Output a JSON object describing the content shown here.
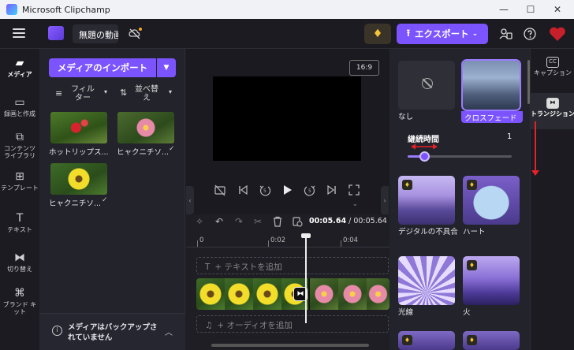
{
  "window": {
    "title": "Microsoft Clipchamp",
    "minimize": "—",
    "maximize": "☐",
    "close": "✕"
  },
  "appbar": {
    "project_name": "無題の動画",
    "export_label": "エクスポート",
    "export_up": "⭱",
    "export_chevron": "⌄",
    "premium_glyph": "♦"
  },
  "leftnav": [
    {
      "label": "メディア",
      "icon": "folder-icon",
      "glyph": "▰"
    },
    {
      "label": "録画と作成",
      "icon": "camera-icon",
      "glyph": "▭"
    },
    {
      "label": "コンテンツ ライブラリ",
      "icon": "library-icon",
      "glyph": "⧉"
    },
    {
      "label": "テンプレート",
      "icon": "templates-icon",
      "glyph": "⊞"
    },
    {
      "label": "テキスト",
      "icon": "text-icon",
      "glyph": "T"
    },
    {
      "label": "切り替え",
      "icon": "transitions-icon",
      "glyph": "⧓"
    },
    {
      "label": "ブランド キット",
      "icon": "brand-kit-icon",
      "glyph": "⌘"
    }
  ],
  "media": {
    "import_label": "メディアのインポート",
    "filter_label": "フィルター",
    "sort_label": "並べ替え",
    "items": [
      {
        "label": "ホットリップス...",
        "checked": false
      },
      {
        "label": "ヒャクニチソ...",
        "checked": true
      },
      {
        "label": "ヒャクニチソ...",
        "checked": true
      }
    ],
    "backup_text": "メディアはバックアップされていません"
  },
  "preview": {
    "aspect_ratio": "16:9"
  },
  "timeline": {
    "current_time": "00:05.64",
    "total_time": "00:05.64",
    "ticks": [
      "0",
      "0:02",
      "0:04"
    ],
    "text_track": "+ テキストを追加",
    "audio_track": "+ オーディオを追加"
  },
  "transitions": {
    "none_label": "なし",
    "selected_label": "クロスフェード",
    "duration_title": "継続時間",
    "duration_value": "1",
    "duration_level": 0.15,
    "items": [
      {
        "label": "デジタルの不具合",
        "premium": true
      },
      {
        "label": "ハート",
        "premium": true
      },
      {
        "label": "光線",
        "premium": false
      },
      {
        "label": "火",
        "premium": true
      }
    ]
  },
  "right_rail": [
    {
      "label": "キャプション",
      "icon": "captions-icon",
      "glyph": "CC"
    },
    {
      "label": "トランジション",
      "icon": "transition-icon",
      "glyph": "⧓"
    }
  ],
  "colors": {
    "accent": "#7c54ff",
    "annotation_red": "#e8202a",
    "premium_gold": "#f5c23a"
  }
}
